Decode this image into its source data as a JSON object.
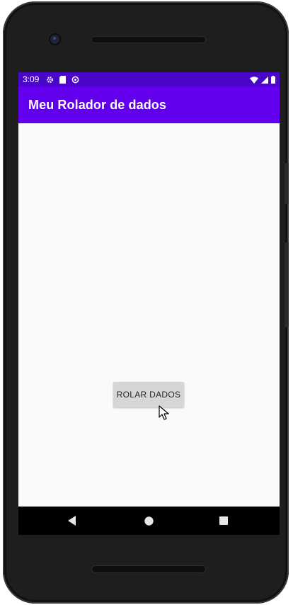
{
  "status_bar": {
    "time": "3:09",
    "left_icons": [
      "gear-icon",
      "sd-card-icon",
      "sync-icon"
    ],
    "right_icons": [
      "wifi-icon",
      "cell-signal-icon",
      "battery-icon"
    ],
    "color": "#4a06c9"
  },
  "app_bar": {
    "title": "Meu Rolador de dados",
    "color": "#6200ee"
  },
  "main": {
    "roll_button_label": "ROLAR DADOS",
    "background": "#fafafa"
  },
  "nav_bar": {
    "buttons": [
      "back-icon",
      "home-icon",
      "recents-icon"
    ]
  }
}
